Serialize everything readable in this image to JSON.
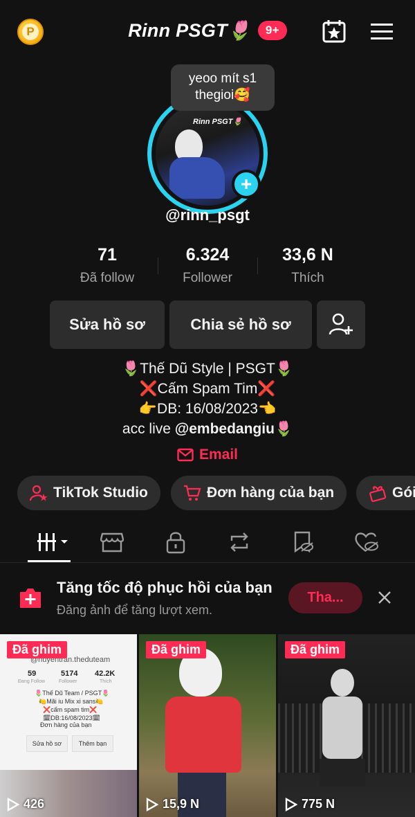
{
  "header": {
    "title": "Rinn PSGT🌷",
    "notification_count": "9+",
    "coin_label": "P"
  },
  "profile": {
    "note": "yeoo mít s1 thegioi🥰",
    "avatar_text": "Rinn PSGT🌷",
    "username": "@rinn_psgt",
    "stats": [
      {
        "value": "71",
        "label": "Đã follow"
      },
      {
        "value": "6.324",
        "label": "Follower"
      },
      {
        "value": "33,6 N",
        "label": "Thích"
      }
    ],
    "buttons": {
      "edit": "Sửa hồ sơ",
      "share": "Chia sẻ hồ sơ"
    },
    "bio": {
      "line1": "🌷Thế Dũ Style | PSGT🌷",
      "line2": "❌Cấm Spam Tim❌",
      "line3": "👉DB: 16/08/2023👈",
      "line4_prefix": "acc live ",
      "line4_mention": "@embedangiu",
      "line4_suffix": "🌷"
    },
    "email_label": "Email"
  },
  "chips": [
    {
      "label": "TikTok Studio",
      "icon": "person-star-icon"
    },
    {
      "label": "Đơn hàng của bạn",
      "icon": "cart-icon"
    },
    {
      "label": "Gói",
      "icon": "gift-icon"
    }
  ],
  "tabs": [
    "videos-grid",
    "shop",
    "private",
    "reposts",
    "favorites",
    "liked"
  ],
  "banner": {
    "title": "Tăng tốc độ phục hồi của bạn",
    "subtitle": "Đăng ảnh để tăng lượt xem.",
    "button": "Tha..."
  },
  "videos": [
    {
      "pinned_label": "Đã ghim",
      "views": "426",
      "inner": {
        "handle": "@huyentran.theduteam",
        "stats": [
          "59",
          "5174",
          "42.2K"
        ],
        "stat_labels": [
          "Đang Follow",
          "Follower",
          "Thích"
        ],
        "bio1": "🌷Thế Dũ Team / PSGT🌷",
        "bio2": "🍋Mãi iu Mix xi sans🍋",
        "bio3": "❌cấm spam tim❌",
        "bio4": "🗓DB:16/08/2023🗓",
        "order": "Đơn hàng của bạn",
        "edit": "Sửa hồ sơ",
        "add": "Thêm bạn"
      }
    },
    {
      "pinned_label": "Đã ghim",
      "views": "15,9 N"
    },
    {
      "pinned_label": "Đã ghim",
      "views": "775 N"
    }
  ],
  "colors": {
    "accent": "#fe2c55",
    "ring": "#2ad3ef",
    "background": "#121212",
    "button_bg": "#2d2d2d"
  }
}
